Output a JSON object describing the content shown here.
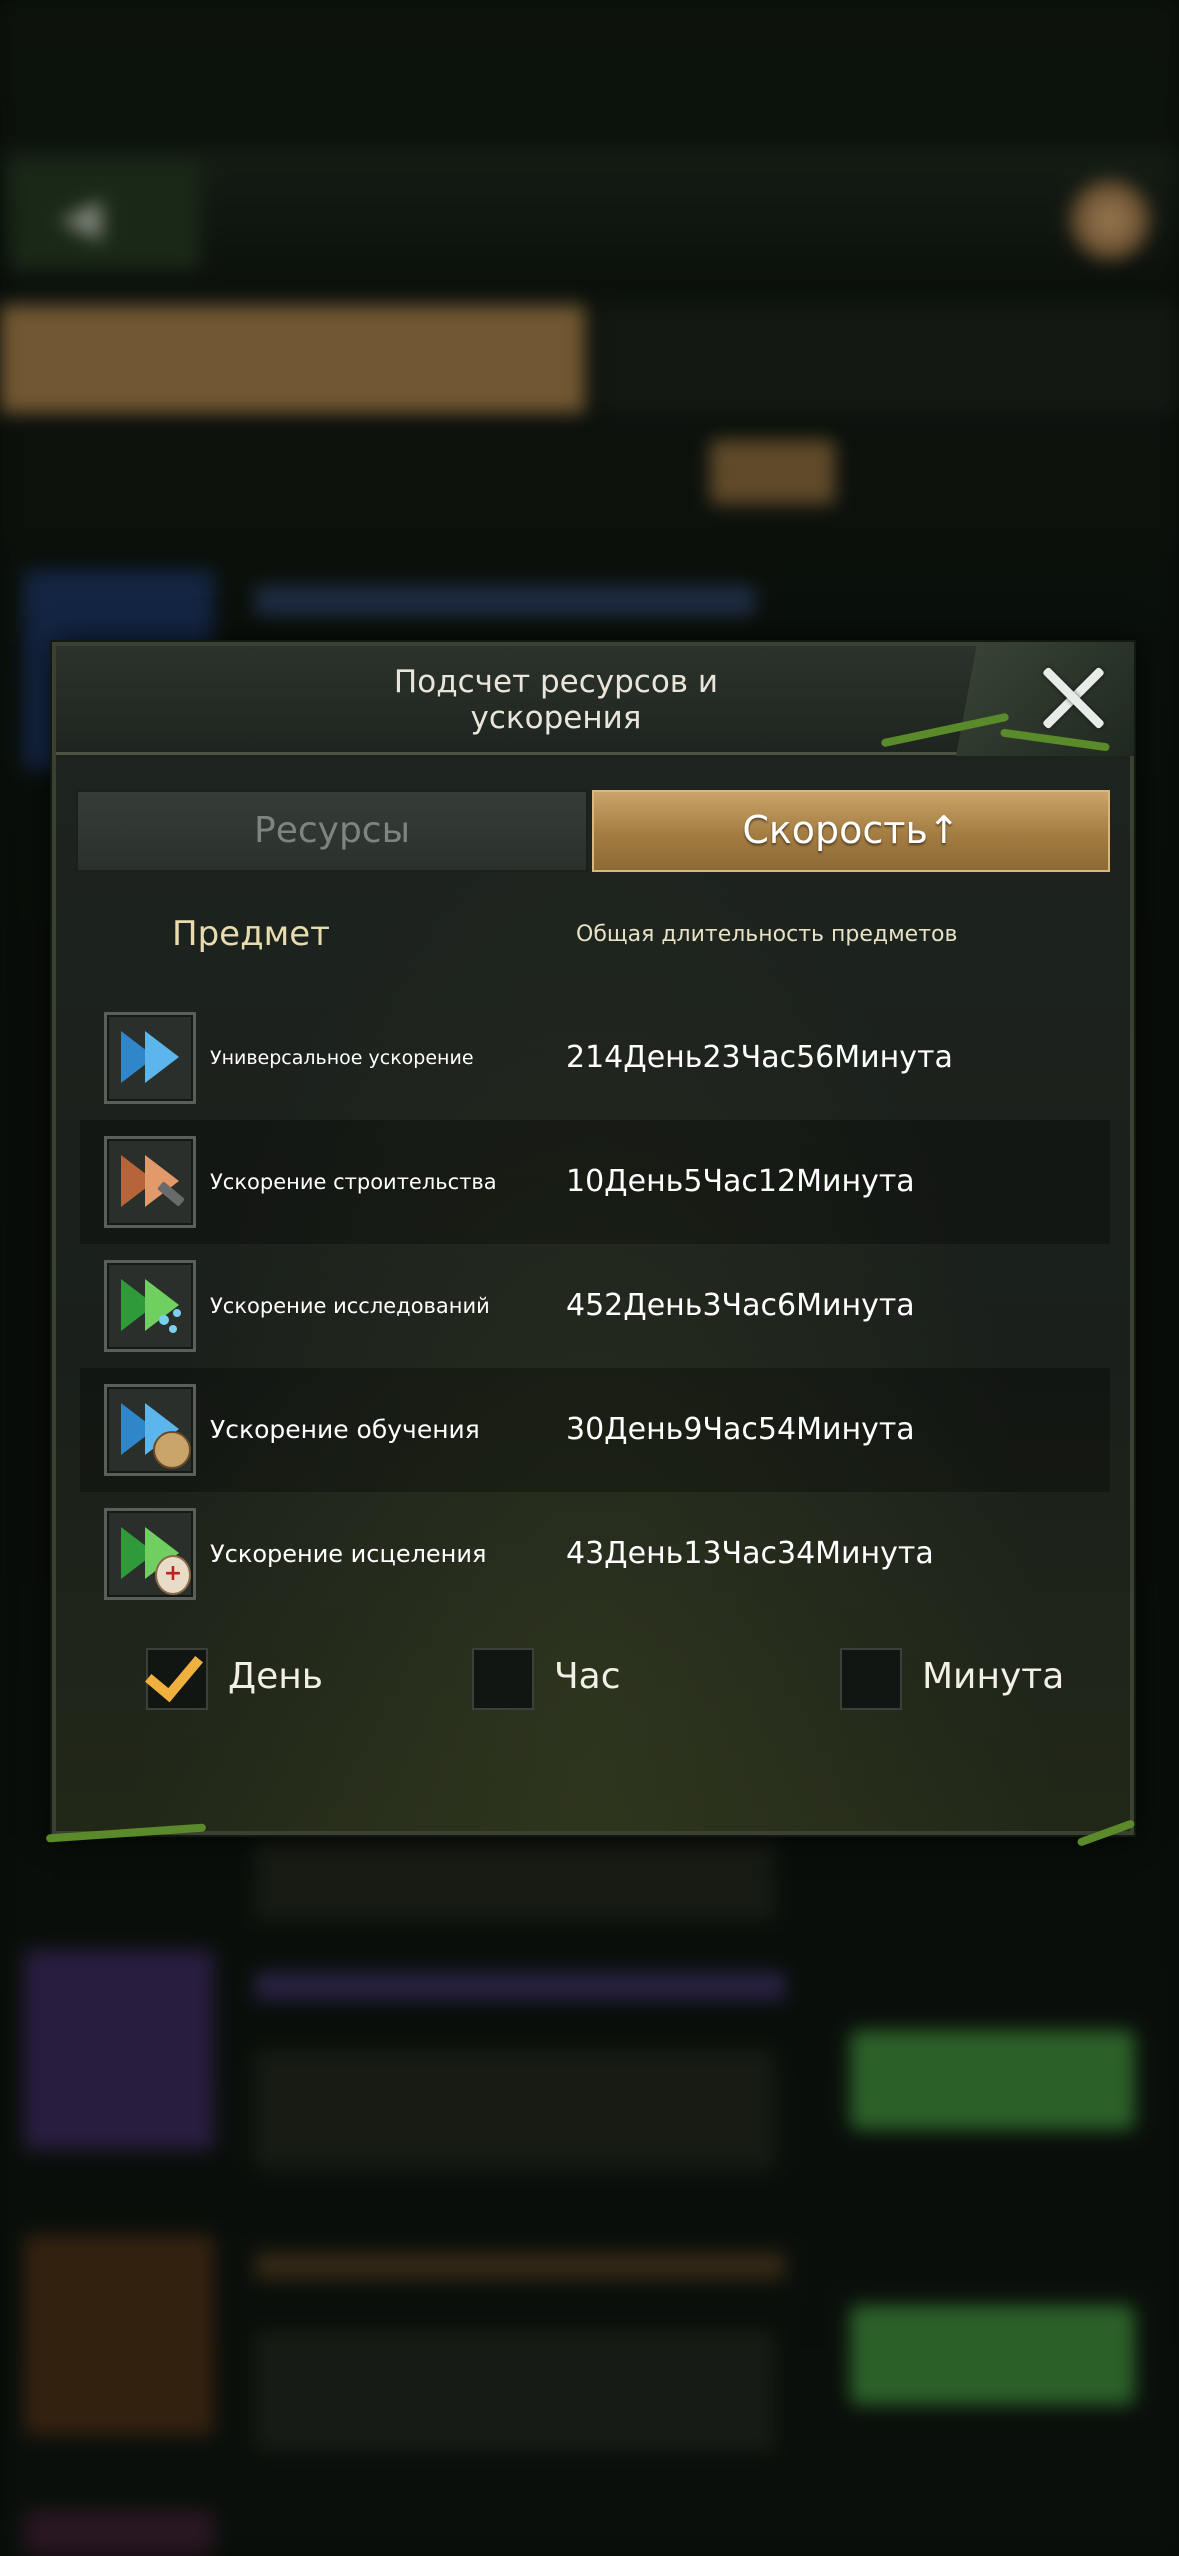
{
  "modal": {
    "title": "Подсчет ресурсов и\nускорения",
    "tabs": {
      "resources": "Ресурсы",
      "speed": "Скорость↑"
    },
    "columns": {
      "item": "Предмет",
      "duration": "Общая длительность предметов"
    },
    "rows": [
      {
        "name": "Универсальное ускорение",
        "duration": "214День23Час56Минута",
        "icon": "universal-speedup-icon"
      },
      {
        "name": "Ускорение строительства",
        "duration": "10День5Час12Минута",
        "icon": "construction-speedup-icon"
      },
      {
        "name": "Ускорение исследований",
        "duration": "452День3Час6Минута",
        "icon": "research-speedup-icon"
      },
      {
        "name": "Ускорение обучения",
        "duration": "30День9Час54Минута",
        "icon": "training-speedup-icon"
      },
      {
        "name": "Ускорение исцеления",
        "duration": "43День13Час34Минута",
        "icon": "healing-speedup-icon"
      }
    ],
    "units": [
      {
        "label": "День",
        "checked": true
      },
      {
        "label": "Час",
        "checked": false
      },
      {
        "label": "Минута",
        "checked": false
      }
    ]
  },
  "colors": {
    "accent_gold": "#a37c42",
    "check_orange": "#f0b040",
    "header_text": "#e8dcae"
  }
}
